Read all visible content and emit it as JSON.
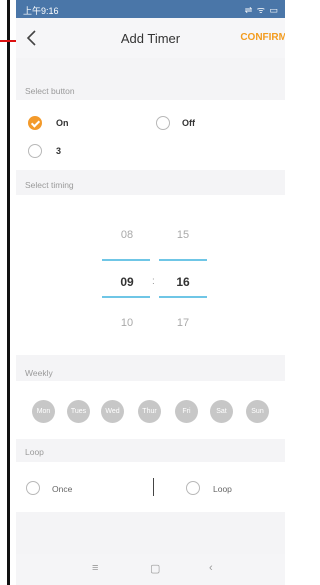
{
  "status_bar": {
    "time": "上午9:16",
    "icons": "⇌ ᯤ ▭"
  },
  "nav": {
    "title": "Add Timer",
    "confirm": "CONFIRM"
  },
  "select_button": {
    "label": "Select button",
    "options": [
      {
        "label": "On",
        "checked": true
      },
      {
        "label": "Off",
        "checked": false
      },
      {
        "label": "3",
        "checked": false
      }
    ]
  },
  "select_timing": {
    "label": "Select timing",
    "hours": [
      "08",
      "09",
      "10"
    ],
    "minutes": [
      "15",
      "16",
      "17"
    ],
    "separator": ":"
  },
  "weekly": {
    "label": "Weekly",
    "days": [
      "Mon",
      "Tues",
      "Wed",
      "Thur",
      "Fri",
      "Sat",
      "Sun"
    ]
  },
  "loop": {
    "label": "Loop",
    "options": [
      {
        "label": "Once",
        "checked": false
      },
      {
        "label": "Loop",
        "checked": false
      }
    ]
  },
  "bottom_nav": {
    "menu": "≡",
    "home": "▢",
    "back": "‹"
  }
}
